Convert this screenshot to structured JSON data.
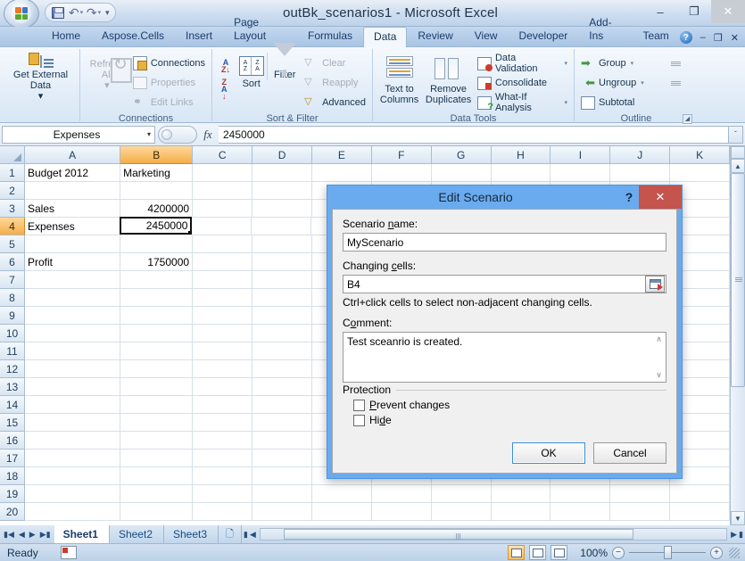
{
  "window": {
    "title": "outBk_scenarios1 - Microsoft Excel",
    "minimize": "–",
    "maximize": "❐",
    "close": "✕"
  },
  "quick_access": {
    "save": "save-icon",
    "undo": "↶",
    "redo": "↷",
    "customize": "▾"
  },
  "ribbon": {
    "tabs": [
      {
        "label": "Home",
        "active": false
      },
      {
        "label": "Aspose.Cells",
        "active": false
      },
      {
        "label": "Insert",
        "active": false
      },
      {
        "label": "Page Layout",
        "active": false
      },
      {
        "label": "Formulas",
        "active": false
      },
      {
        "label": "Data",
        "active": true
      },
      {
        "label": "Review",
        "active": false
      },
      {
        "label": "View",
        "active": false
      },
      {
        "label": "Developer",
        "active": false
      },
      {
        "label": "Add-Ins",
        "active": false
      },
      {
        "label": "Team",
        "active": false
      }
    ],
    "help_label": "?",
    "minimize_ribbon": "–",
    "restore_window": "❐",
    "close_window": "✕",
    "groups": {
      "get_external": {
        "title": "",
        "button": "Get External Data",
        "dropdown": "▾"
      },
      "connections": {
        "title": "Connections",
        "refresh_all": "Refresh All",
        "refresh_dropdown": "▾",
        "items": [
          "Connections",
          "Properties",
          "Edit Links"
        ]
      },
      "sort_filter": {
        "title": "Sort & Filter",
        "sort_asc": "A↓",
        "sort_desc": "Z↓",
        "sort": "Sort",
        "filter": "Filter",
        "clear": "Clear",
        "reapply": "Reapply",
        "advanced": "Advanced"
      },
      "data_tools": {
        "title": "Data Tools",
        "text_to_columns": "Text to Columns",
        "remove_duplicates": "Remove Duplicates",
        "data_validation": "Data Validation",
        "consolidate": "Consolidate",
        "what_if": "What-If Analysis",
        "caret": "▾"
      },
      "outline": {
        "title": "Outline",
        "group": "Group",
        "ungroup": "Ungroup",
        "subtotal": "Subtotal",
        "caret": "▾",
        "launcher": "⤵"
      }
    }
  },
  "formula_bar": {
    "name_box": "Expenses",
    "name_box_caret": "▾",
    "fx": "fx",
    "value": "2450000",
    "expand_caret": "ˇ"
  },
  "grid": {
    "columns": [
      "A",
      "B",
      "C",
      "D",
      "E",
      "F",
      "G",
      "H",
      "I",
      "J",
      "K"
    ],
    "selected_column": "B",
    "selected_row": 4,
    "rows": [
      {
        "n": "1",
        "cells": {
          "A": "Budget 2012",
          "B": "Marketing"
        }
      },
      {
        "n": "2",
        "cells": {}
      },
      {
        "n": "3",
        "cells": {
          "A": "Sales",
          "B": "4200000"
        }
      },
      {
        "n": "4",
        "cells": {
          "A": "Expenses",
          "B": "2450000"
        }
      },
      {
        "n": "5",
        "cells": {}
      },
      {
        "n": "6",
        "cells": {
          "A": "Profit",
          "B": "1750000"
        }
      },
      {
        "n": "7",
        "cells": {}
      },
      {
        "n": "8",
        "cells": {}
      },
      {
        "n": "9",
        "cells": {}
      },
      {
        "n": "10",
        "cells": {}
      },
      {
        "n": "11",
        "cells": {}
      },
      {
        "n": "12",
        "cells": {}
      },
      {
        "n": "13",
        "cells": {}
      },
      {
        "n": "14",
        "cells": {}
      },
      {
        "n": "15",
        "cells": {}
      },
      {
        "n": "16",
        "cells": {}
      },
      {
        "n": "17",
        "cells": {}
      },
      {
        "n": "18",
        "cells": {}
      },
      {
        "n": "19",
        "cells": {}
      },
      {
        "n": "20",
        "cells": {}
      }
    ],
    "numeric_columns": [
      "B"
    ],
    "active_cell": "B4"
  },
  "sheet_tabs": {
    "first": "❘◀",
    "prev": "◀",
    "next": "▶",
    "last": "▶❘",
    "items": [
      {
        "label": "Sheet1",
        "active": true
      },
      {
        "label": "Sheet2",
        "active": false
      },
      {
        "label": "Sheet3",
        "active": false
      }
    ],
    "insert_sheet": "insert-worksheet-icon"
  },
  "status_bar": {
    "mode": "Ready",
    "macro_record": "record-macro-icon",
    "views": [
      {
        "name": "normal-view",
        "active": true
      },
      {
        "name": "page-layout-view",
        "active": false
      },
      {
        "name": "page-break-preview",
        "active": false
      }
    ],
    "zoom": "100%",
    "zoom_out": "−",
    "zoom_in": "+"
  },
  "dialog": {
    "title": "Edit Scenario",
    "help": "?",
    "close": "✕",
    "scenario_name_label": "Scenario name:",
    "scenario_name_label_pre": "Scenario ",
    "scenario_name_label_accel": "n",
    "scenario_name_label_post": "ame:",
    "scenario_name_value": "MyScenario",
    "changing_cells_label_pre": "Changing ",
    "changing_cells_label_accel": "c",
    "changing_cells_label_post": "ells:",
    "changing_cells_value": "B4",
    "range_picker": "range-select-icon",
    "hint": "Ctrl+click cells to select non-adjacent changing cells.",
    "comment_label_pre": "C",
    "comment_label_accel": "o",
    "comment_label_post": "mment:",
    "comment_value": "Test sceanrio is created.",
    "scroll_up": "∧",
    "scroll_down": "∨",
    "protection_legend": "Protection",
    "prevent_changes_pre": "",
    "prevent_changes_accel": "P",
    "prevent_changes_post": "revent changes",
    "hide_pre": "Hi",
    "hide_accel": "d",
    "hide_post": "e",
    "ok": "OK",
    "cancel": "Cancel"
  },
  "colors": {
    "dialog_title_bar": "#6aabef",
    "close_button": "#c4544c",
    "selected_header": "#f4ad4a",
    "ribbon_active_tab": "#f2f7fc"
  }
}
